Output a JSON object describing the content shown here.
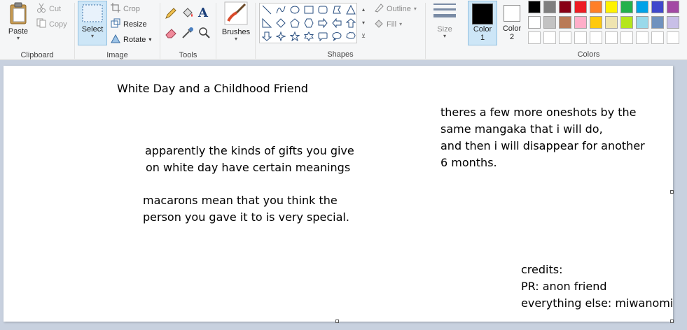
{
  "ribbon": {
    "clipboard": {
      "label": "Clipboard",
      "paste": "Paste",
      "cut": "Cut",
      "copy": "Copy"
    },
    "image": {
      "label": "Image",
      "select": "Select",
      "crop": "Crop",
      "resize": "Resize",
      "rotate": "Rotate"
    },
    "tools": {
      "label": "Tools"
    },
    "brushes": {
      "label": "Brushes"
    },
    "shapes": {
      "label": "Shapes",
      "outline": "Outline",
      "fill": "Fill"
    },
    "size": {
      "label": "Size"
    },
    "colors": {
      "label": "Colors",
      "color1": "Color\n1",
      "color1_line1": "Color",
      "color1_line2": "1",
      "color2_line1": "Color",
      "color2_line2": "2",
      "color1_value": "#000000",
      "color2_value": "#ffffff",
      "palette_row1": [
        "#000000",
        "#7f7f7f",
        "#880015",
        "#ed1c24",
        "#ff7f27",
        "#fff200",
        "#22b14c",
        "#00a2e8",
        "#3f48cc",
        "#a349a4"
      ],
      "palette_row2": [
        "#ffffff",
        "#c3c3c3",
        "#b97a57",
        "#ffaec9",
        "#ffc90e",
        "#efe4b0",
        "#b5e61d",
        "#99d9ea",
        "#7092be",
        "#c8bfe7"
      ]
    }
  },
  "canvas": {
    "title": "White Day and a Childhood Friend",
    "note_lines": [
      "theres a few more oneshots by the",
      "same mangaka that i will do,",
      "and then i will disappear for another",
      "6 months."
    ],
    "gifts_lines": [
      "apparently the kinds of gifts you give",
      "on white day have certain meanings"
    ],
    "macaron_lines": [
      "macarons mean that you think the",
      "person you gave it to is very special."
    ],
    "credits_lines": [
      "credits:",
      "PR: anon friend",
      "everything else: miwanomi"
    ]
  }
}
